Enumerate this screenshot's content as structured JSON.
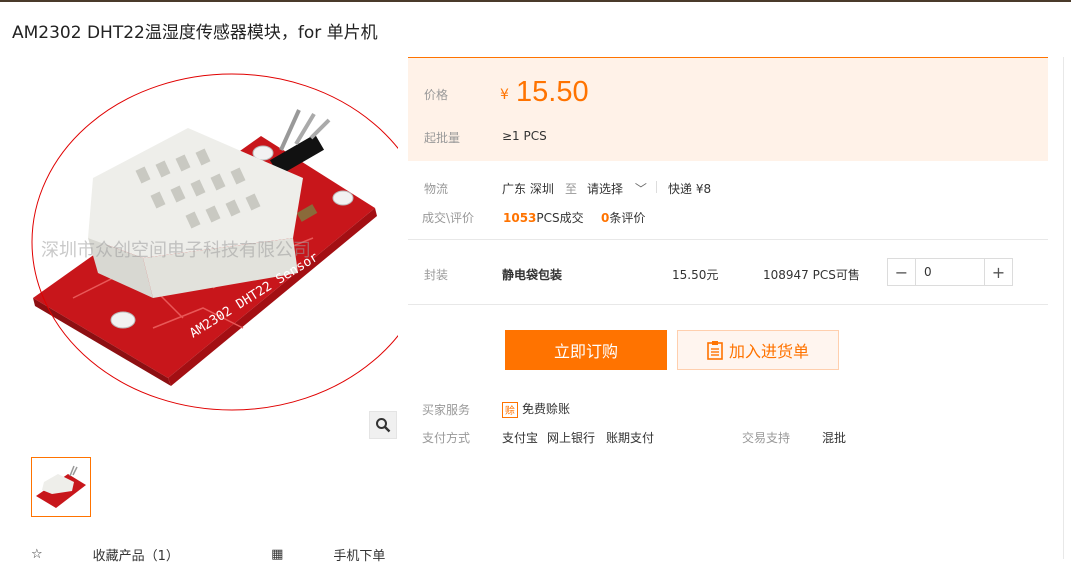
{
  "product": {
    "title": "AM2302 DHT22温湿度传感器模块，for 单片机",
    "image_watermark": "深圳市众创空间电子科技有限公司",
    "board_label": "AM2302 DHT22 Sensor"
  },
  "price": {
    "label": "价格",
    "currency": "¥",
    "value": "15.50"
  },
  "moq": {
    "label": "起批量",
    "value": "≥1  PCS"
  },
  "logistics": {
    "label": "物流",
    "from": "广东 深圳",
    "to_word": "至",
    "dest_placeholder": "请选择",
    "express": "快递 ¥8"
  },
  "deals": {
    "label": "成交\\评价",
    "count": "1053",
    "count_suffix": "PCS成交",
    "reviews": "0",
    "reviews_suffix": "条评价"
  },
  "sku": {
    "label": "封装",
    "name": "静电袋包装",
    "price": "15.50元",
    "stock": "108947 PCS可售",
    "quantity": "0",
    "minus": "−",
    "plus": "+"
  },
  "actions": {
    "buy_now": "立即订购",
    "add_to_list": "加入进货单"
  },
  "services": {
    "label": "买家服务",
    "badge": "赊",
    "item": "免费赊账"
  },
  "payment": {
    "label": "支付方式",
    "methods": [
      "支付宝",
      "网上银行",
      "账期支付"
    ],
    "trade_label": "交易支持",
    "trade_value": "混批"
  },
  "bottom": {
    "favorite": "收藏产品（1）",
    "mobile": "手机下单"
  },
  "colors": {
    "accent": "#ff7300",
    "price_bg": "#fff2e8",
    "board_red": "#d81e1e"
  }
}
